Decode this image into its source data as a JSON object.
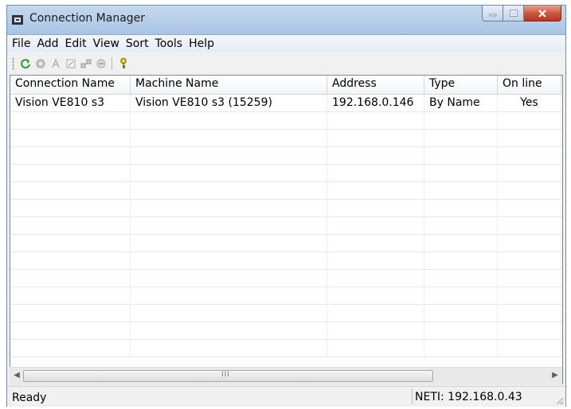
{
  "window": {
    "title": "Connection Manager"
  },
  "menu": [
    "File",
    "Add",
    "Edit",
    "View",
    "Sort",
    "Tools",
    "Help"
  ],
  "toolbar": {
    "buttons": [
      {
        "icon": "refresh-icon"
      },
      {
        "icon": "add-connection-icon"
      },
      {
        "icon": "rename-icon"
      },
      {
        "icon": "edit-icon"
      },
      {
        "icon": "network-icon"
      },
      {
        "icon": "delete-icon"
      },
      {
        "icon": "key-icon"
      }
    ]
  },
  "table": {
    "columns": [
      "Connection Name",
      "Machine Name",
      "Address",
      "Type",
      "On line"
    ],
    "rows": [
      [
        "Vision VE810 s3",
        "Vision VE810 s3 (15259)",
        "192.168.0.146",
        "By Name",
        "Yes"
      ]
    ]
  },
  "scrollbar": {
    "grip": "III"
  },
  "status": {
    "text": "Ready",
    "panel": "NETI: 192.168.0.43"
  },
  "colors": {
    "titlebar": "#b9d0ea",
    "close_button": "#c8533b",
    "refresh_icon": "#2e9a2e",
    "key_icon": "#c9a800"
  }
}
